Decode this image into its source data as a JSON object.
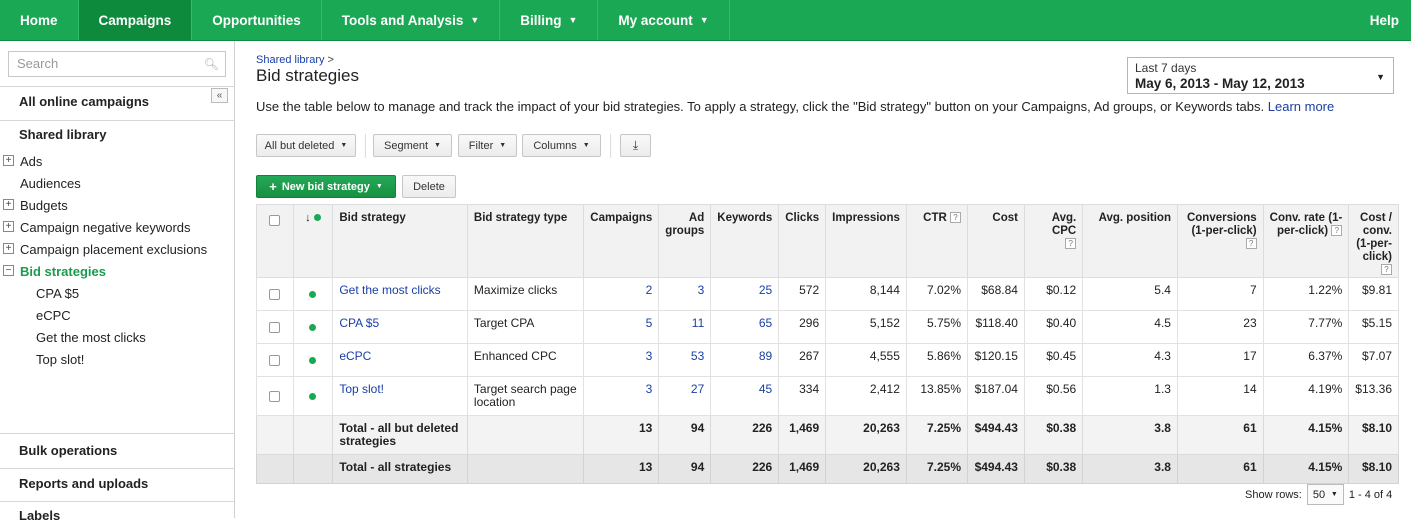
{
  "nav": {
    "items": [
      {
        "label": "Home",
        "dropdown": false,
        "active": false
      },
      {
        "label": "Campaigns",
        "dropdown": false,
        "active": true
      },
      {
        "label": "Opportunities",
        "dropdown": false,
        "active": false
      },
      {
        "label": "Tools and Analysis",
        "dropdown": true,
        "active": false
      },
      {
        "label": "Billing",
        "dropdown": true,
        "active": false
      },
      {
        "label": "My account",
        "dropdown": true,
        "active": false
      }
    ],
    "help": "Help"
  },
  "sidebar": {
    "search_placeholder": "Search",
    "all_campaigns": "All online campaigns",
    "shared_library": "Shared library",
    "library_items": [
      "Ads",
      "Audiences",
      "Budgets",
      "Campaign negative keywords",
      "Campaign placement exclusions",
      "Bid strategies"
    ],
    "bid_strategies": [
      "CPA $5",
      "eCPC",
      "Get the most clicks",
      "Top slot!"
    ],
    "bulk_operations": "Bulk operations",
    "reports": "Reports and uploads",
    "labels": "Labels"
  },
  "breadcrumb": "Shared library",
  "page_title": "Bid strategies",
  "date_range": {
    "label": "Last 7 days",
    "value": "May 6, 2013 - May 12, 2013"
  },
  "description": "Use the table below to manage and track the impact of your bid strategies. To apply a strategy, click the \"Bid strategy\" button on your Campaigns, Ad groups, or Keywords tabs.",
  "learn_more": "Learn more",
  "toolbar": {
    "status_filter": "All but deleted",
    "segment": "Segment",
    "filter": "Filter",
    "columns": "Columns",
    "new_strategy": "New bid strategy",
    "delete": "Delete"
  },
  "table": {
    "headers": {
      "bid_strategy": "Bid strategy",
      "type": "Bid strategy type",
      "campaigns": "Campaigns",
      "ad_groups": "Ad groups",
      "keywords": "Keywords",
      "clicks": "Clicks",
      "impressions": "Impressions",
      "ctr": "CTR",
      "cost": "Cost",
      "avg_cpc": "Avg. CPC",
      "avg_position": "Avg. position",
      "conversions": "Conversions (1-per-click)",
      "conv_rate": "Conv. rate (1-per-click)",
      "cost_per_conv": "Cost / conv. (1-per-click)"
    },
    "rows": [
      {
        "name": "Get the most clicks",
        "type": "Maximize clicks",
        "campaigns": "2",
        "ad_groups": "3",
        "keywords": "25",
        "clicks": "572",
        "impressions": "8,144",
        "ctr": "7.02%",
        "cost": "$68.84",
        "avg_cpc": "$0.12",
        "avg_position": "5.4",
        "conversions": "7",
        "conv_rate": "1.22%",
        "cost_per_conv": "$9.81"
      },
      {
        "name": "CPA $5",
        "type": "Target CPA",
        "campaigns": "5",
        "ad_groups": "11",
        "keywords": "65",
        "clicks": "296",
        "impressions": "5,152",
        "ctr": "5.75%",
        "cost": "$118.40",
        "avg_cpc": "$0.40",
        "avg_position": "4.5",
        "conversions": "23",
        "conv_rate": "7.77%",
        "cost_per_conv": "$5.15"
      },
      {
        "name": "eCPC",
        "type": "Enhanced CPC",
        "campaigns": "3",
        "ad_groups": "53",
        "keywords": "89",
        "clicks": "267",
        "impressions": "4,555",
        "ctr": "5.86%",
        "cost": "$120.15",
        "avg_cpc": "$0.45",
        "avg_position": "4.3",
        "conversions": "17",
        "conv_rate": "6.37%",
        "cost_per_conv": "$7.07"
      },
      {
        "name": "Top slot!",
        "type": "Target search page location",
        "campaigns": "3",
        "ad_groups": "27",
        "keywords": "45",
        "clicks": "334",
        "impressions": "2,412",
        "ctr": "13.85%",
        "cost": "$187.04",
        "avg_cpc": "$0.56",
        "avg_position": "1.3",
        "conversions": "14",
        "conv_rate": "4.19%",
        "cost_per_conv": "$13.36"
      }
    ],
    "totals": [
      {
        "name": "Total - all but deleted strategies",
        "campaigns": "13",
        "ad_groups": "94",
        "keywords": "226",
        "clicks": "1,469",
        "impressions": "20,263",
        "ctr": "7.25%",
        "cost": "$494.43",
        "avg_cpc": "$0.38",
        "avg_position": "3.8",
        "conversions": "61",
        "conv_rate": "4.15%",
        "cost_per_conv": "$8.10"
      },
      {
        "name": "Total - all strategies",
        "campaigns": "13",
        "ad_groups": "94",
        "keywords": "226",
        "clicks": "1,469",
        "impressions": "20,263",
        "ctr": "7.25%",
        "cost": "$494.43",
        "avg_cpc": "$0.38",
        "avg_position": "3.8",
        "conversions": "61",
        "conv_rate": "4.15%",
        "cost_per_conv": "$8.10"
      }
    ]
  },
  "footer": {
    "show_rows_label": "Show rows:",
    "rows_value": "50",
    "range": "1 - 4 of 4"
  },
  "colors": {
    "brand_green": "#1ba854",
    "link_blue": "#1a3fa3"
  }
}
